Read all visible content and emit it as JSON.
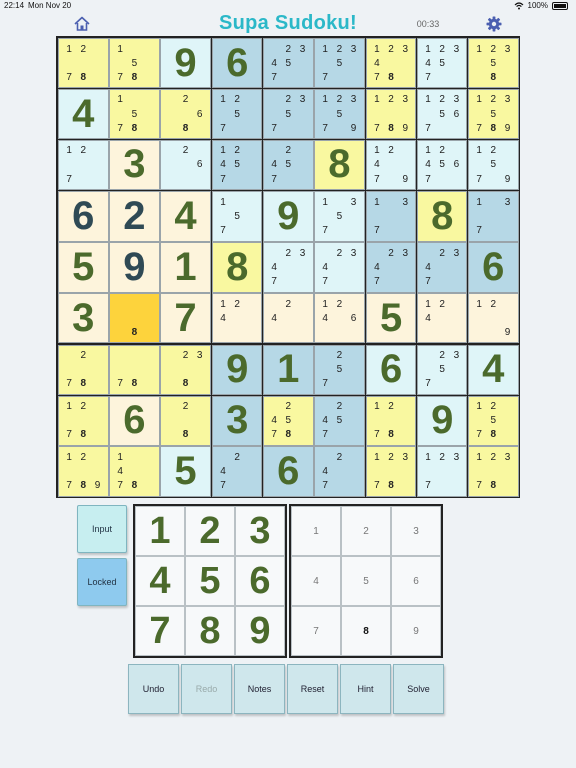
{
  "status": {
    "time": "22:14",
    "date": "Mon Nov 20",
    "battery": "100%"
  },
  "header": {
    "title": "Supa Sudoku!",
    "timer": "00:33"
  },
  "colors": {
    "yellow": "#f9f8a0",
    "lightblue": "#dff5f8",
    "blue": "#b6d8e6",
    "cream": "#fdf4dc",
    "gold": "#fdd33c",
    "given": "#2f4a55",
    "user": "#4b6a2c"
  },
  "board": {
    "rows": [
      [
        {
          "b": "yellow",
          "n": [
            1,
            2,
            0,
            0,
            0,
            0,
            7,
            8,
            0
          ],
          "h": [
            8
          ]
        },
        {
          "b": "yellow",
          "n": [
            1,
            0,
            0,
            0,
            5,
            0,
            7,
            8,
            0
          ],
          "h": [
            8
          ]
        },
        {
          "b": "lightblue",
          "v": 9,
          "t": "u"
        },
        {
          "b": "blue",
          "v": 6,
          "t": "u"
        },
        {
          "b": "blue",
          "n": [
            0,
            2,
            3,
            4,
            5,
            0,
            7,
            0,
            0
          ]
        },
        {
          "b": "blue",
          "n": [
            1,
            2,
            3,
            0,
            5,
            0,
            7,
            0,
            0
          ]
        },
        {
          "b": "yellow",
          "n": [
            1,
            2,
            3,
            4,
            0,
            0,
            7,
            8,
            0
          ],
          "h": [
            8
          ]
        },
        {
          "b": "lightblue",
          "n": [
            1,
            2,
            3,
            4,
            5,
            0,
            7,
            0,
            0
          ]
        },
        {
          "b": "yellow",
          "n": [
            1,
            2,
            3,
            0,
            5,
            0,
            0,
            8,
            0
          ],
          "h": [
            8
          ]
        }
      ],
      [
        {
          "b": "lightblue",
          "v": 4,
          "t": "u"
        },
        {
          "b": "yellow",
          "n": [
            1,
            0,
            0,
            0,
            5,
            0,
            7,
            8,
            0
          ],
          "h": [
            8
          ]
        },
        {
          "b": "yellow",
          "n": [
            0,
            2,
            0,
            0,
            0,
            6,
            0,
            8,
            0
          ],
          "h": [
            8
          ]
        },
        {
          "b": "blue",
          "n": [
            1,
            2,
            0,
            0,
            5,
            0,
            7,
            0,
            0
          ]
        },
        {
          "b": "blue",
          "n": [
            0,
            2,
            3,
            0,
            5,
            0,
            7,
            0,
            0
          ]
        },
        {
          "b": "blue",
          "n": [
            1,
            2,
            3,
            0,
            5,
            0,
            7,
            0,
            9
          ]
        },
        {
          "b": "yellow",
          "n": [
            1,
            2,
            3,
            0,
            0,
            0,
            7,
            8,
            9
          ],
          "h": [
            8
          ]
        },
        {
          "b": "lightblue",
          "n": [
            1,
            2,
            3,
            0,
            5,
            6,
            7,
            0,
            0
          ]
        },
        {
          "b": "yellow",
          "n": [
            1,
            2,
            3,
            0,
            5,
            0,
            7,
            8,
            9
          ],
          "h": [
            8
          ]
        }
      ],
      [
        {
          "b": "lightblue",
          "n": [
            1,
            2,
            0,
            0,
            0,
            0,
            7,
            0,
            0
          ]
        },
        {
          "b": "cream",
          "v": 3,
          "t": "u"
        },
        {
          "b": "lightblue",
          "n": [
            0,
            2,
            0,
            0,
            0,
            6,
            0,
            0,
            0
          ]
        },
        {
          "b": "blue",
          "n": [
            1,
            2,
            0,
            4,
            5,
            0,
            7,
            0,
            0
          ]
        },
        {
          "b": "blue",
          "n": [
            0,
            2,
            0,
            4,
            5,
            0,
            7,
            0,
            0
          ]
        },
        {
          "b": "yellow",
          "v": 8,
          "t": "u"
        },
        {
          "b": "lightblue",
          "n": [
            1,
            2,
            0,
            4,
            0,
            0,
            7,
            0,
            9
          ]
        },
        {
          "b": "lightblue",
          "n": [
            1,
            2,
            0,
            4,
            5,
            6,
            7,
            0,
            0
          ]
        },
        {
          "b": "lightblue",
          "n": [
            1,
            2,
            0,
            0,
            5,
            0,
            7,
            0,
            9
          ]
        }
      ],
      [
        {
          "b": "cream",
          "v": 6,
          "t": "g"
        },
        {
          "b": "cream",
          "v": 2,
          "t": "g"
        },
        {
          "b": "cream",
          "v": 4,
          "t": "u"
        },
        {
          "b": "lightblue",
          "n": [
            1,
            0,
            0,
            0,
            5,
            0,
            7,
            0,
            0
          ]
        },
        {
          "b": "lightblue",
          "v": 9,
          "t": "u"
        },
        {
          "b": "lightblue",
          "n": [
            1,
            0,
            3,
            0,
            5,
            0,
            7,
            0,
            0
          ]
        },
        {
          "b": "blue",
          "n": [
            1,
            0,
            3,
            0,
            0,
            0,
            7,
            0,
            0
          ]
        },
        {
          "b": "yellow",
          "v": 8,
          "t": "u"
        },
        {
          "b": "blue",
          "n": [
            1,
            0,
            3,
            0,
            0,
            0,
            7,
            0,
            0
          ]
        }
      ],
      [
        {
          "b": "cream",
          "v": 5,
          "t": "u"
        },
        {
          "b": "cream",
          "v": 9,
          "t": "g"
        },
        {
          "b": "cream",
          "v": 1,
          "t": "u"
        },
        {
          "b": "yellow",
          "v": 8,
          "t": "u"
        },
        {
          "b": "lightblue",
          "n": [
            0,
            2,
            3,
            4,
            0,
            0,
            7,
            0,
            0
          ]
        },
        {
          "b": "lightblue",
          "n": [
            0,
            2,
            3,
            4,
            0,
            0,
            7,
            0,
            0
          ]
        },
        {
          "b": "blue",
          "n": [
            0,
            2,
            3,
            4,
            0,
            0,
            7,
            0,
            0
          ]
        },
        {
          "b": "blue",
          "n": [
            0,
            2,
            3,
            4,
            0,
            0,
            7,
            0,
            0
          ]
        },
        {
          "b": "blue",
          "v": 6,
          "t": "u"
        }
      ],
      [
        {
          "b": "cream",
          "v": 3,
          "t": "u"
        },
        {
          "b": "gold",
          "n": [
            0,
            0,
            0,
            0,
            0,
            0,
            0,
            8,
            0
          ],
          "h": [
            8
          ]
        },
        {
          "b": "cream",
          "v": 7,
          "t": "u"
        },
        {
          "b": "cream",
          "n": [
            1,
            2,
            0,
            4,
            0,
            0,
            0,
            0,
            0
          ]
        },
        {
          "b": "cream",
          "n": [
            0,
            2,
            0,
            4,
            0,
            0,
            0,
            0,
            0
          ]
        },
        {
          "b": "cream",
          "n": [
            1,
            2,
            0,
            4,
            0,
            6,
            0,
            0,
            0
          ]
        },
        {
          "b": "cream",
          "v": 5,
          "t": "u"
        },
        {
          "b": "cream",
          "n": [
            1,
            2,
            0,
            4,
            0,
            0,
            0,
            0,
            0
          ]
        },
        {
          "b": "cream",
          "n": [
            1,
            2,
            0,
            0,
            0,
            0,
            0,
            0,
            9
          ]
        }
      ],
      [
        {
          "b": "yellow",
          "n": [
            0,
            2,
            0,
            0,
            0,
            0,
            7,
            8,
            0
          ],
          "h": [
            8
          ]
        },
        {
          "b": "yellow",
          "n": [
            0,
            0,
            0,
            0,
            0,
            0,
            7,
            8,
            0
          ],
          "h": [
            8
          ]
        },
        {
          "b": "yellow",
          "n": [
            0,
            2,
            3,
            0,
            0,
            0,
            0,
            8,
            0
          ],
          "h": [
            8
          ]
        },
        {
          "b": "blue",
          "v": 9,
          "t": "u"
        },
        {
          "b": "blue",
          "v": 1,
          "t": "u"
        },
        {
          "b": "blue",
          "n": [
            0,
            2,
            0,
            0,
            5,
            0,
            7,
            0,
            0
          ]
        },
        {
          "b": "lightblue",
          "v": 6,
          "t": "u"
        },
        {
          "b": "lightblue",
          "n": [
            0,
            2,
            3,
            0,
            5,
            0,
            7,
            0,
            0
          ]
        },
        {
          "b": "lightblue",
          "v": 4,
          "t": "u"
        }
      ],
      [
        {
          "b": "yellow",
          "n": [
            1,
            2,
            0,
            0,
            0,
            0,
            7,
            8,
            0
          ],
          "h": [
            8
          ]
        },
        {
          "b": "cream",
          "v": 6,
          "t": "u"
        },
        {
          "b": "yellow",
          "n": [
            0,
            2,
            0,
            0,
            0,
            0,
            0,
            8,
            0
          ],
          "h": [
            8
          ]
        },
        {
          "b": "blue",
          "v": 3,
          "t": "u"
        },
        {
          "b": "yellow",
          "n": [
            0,
            2,
            0,
            4,
            5,
            0,
            7,
            8,
            0
          ],
          "h": [
            8
          ]
        },
        {
          "b": "blue",
          "n": [
            0,
            2,
            0,
            4,
            5,
            0,
            7,
            0,
            0
          ]
        },
        {
          "b": "yellow",
          "n": [
            1,
            2,
            0,
            0,
            0,
            0,
            7,
            8,
            0
          ],
          "h": [
            8
          ]
        },
        {
          "b": "lightblue",
          "v": 9,
          "t": "u"
        },
        {
          "b": "yellow",
          "n": [
            1,
            2,
            0,
            0,
            5,
            0,
            7,
            8,
            0
          ],
          "h": [
            8
          ]
        }
      ],
      [
        {
          "b": "yellow",
          "n": [
            1,
            2,
            0,
            0,
            0,
            0,
            7,
            8,
            9
          ],
          "h": [
            8
          ]
        },
        {
          "b": "yellow",
          "n": [
            1,
            0,
            0,
            4,
            0,
            0,
            7,
            8,
            0
          ],
          "h": [
            8
          ]
        },
        {
          "b": "lightblue",
          "v": 5,
          "t": "u"
        },
        {
          "b": "blue",
          "n": [
            0,
            2,
            0,
            4,
            0,
            0,
            7,
            0,
            0
          ]
        },
        {
          "b": "blue",
          "v": 6,
          "t": "u"
        },
        {
          "b": "blue",
          "n": [
            0,
            2,
            0,
            4,
            0,
            0,
            7,
            0,
            0
          ]
        },
        {
          "b": "yellow",
          "n": [
            1,
            2,
            3,
            0,
            0,
            0,
            7,
            8,
            0
          ],
          "h": [
            8
          ]
        },
        {
          "b": "lightblue",
          "n": [
            1,
            2,
            3,
            0,
            0,
            0,
            7,
            0,
            0
          ]
        },
        {
          "b": "yellow",
          "n": [
            1,
            2,
            3,
            0,
            0,
            0,
            7,
            8,
            0
          ],
          "h": [
            8
          ]
        }
      ]
    ]
  },
  "mode_buttons": {
    "input": "Input",
    "locked": "Locked"
  },
  "keypad_big": [
    "1",
    "2",
    "3",
    "4",
    "5",
    "6",
    "7",
    "8",
    "9"
  ],
  "keypad_small": [
    "1",
    "2",
    "3",
    "4",
    "5",
    "6",
    "7",
    "8",
    "9"
  ],
  "keypad_small_selected": "8",
  "toolbar": [
    {
      "label": "Undo",
      "enabled": true
    },
    {
      "label": "Redo",
      "enabled": false
    },
    {
      "label": "Notes",
      "enabled": true
    },
    {
      "label": "Reset",
      "enabled": true
    },
    {
      "label": "Hint",
      "enabled": true
    },
    {
      "label": "Solve",
      "enabled": true
    }
  ]
}
